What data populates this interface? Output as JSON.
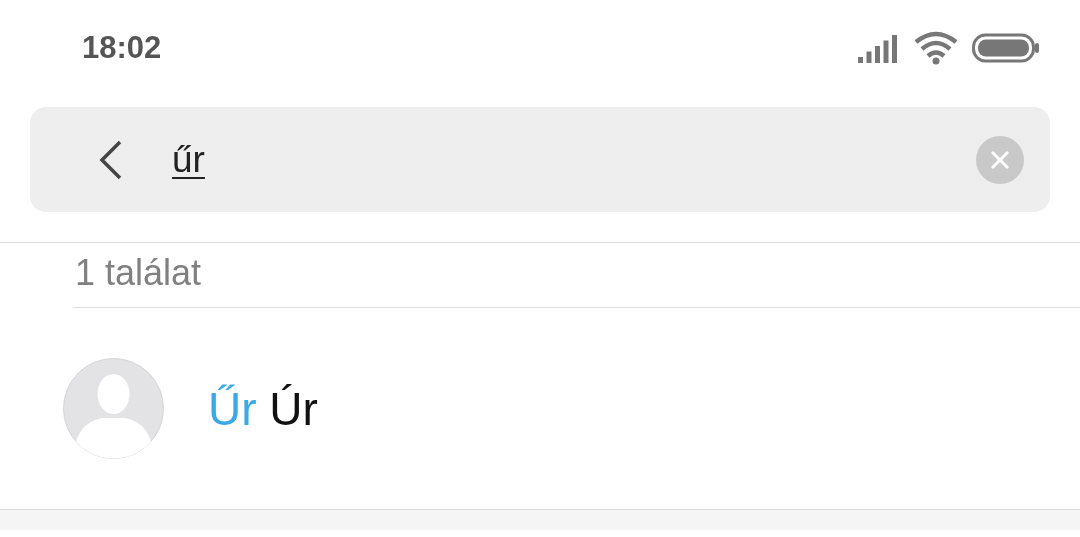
{
  "status_bar": {
    "time": "18:02"
  },
  "search": {
    "value": "űr",
    "composing": true
  },
  "results": {
    "count_label": "1 találat",
    "items": [
      {
        "name_parts": [
          {
            "text": "Űr",
            "highlighted": true
          },
          {
            "text": " Úr",
            "highlighted": false
          }
        ]
      }
    ]
  }
}
